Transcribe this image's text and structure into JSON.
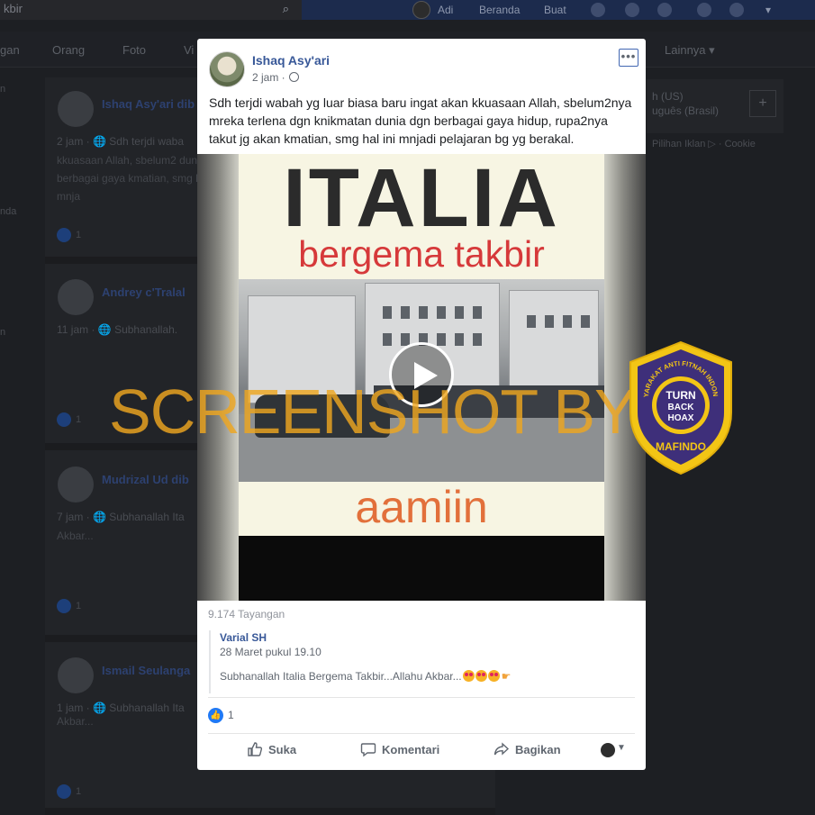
{
  "topbar": {
    "search_value": "kbir",
    "user_name": "Adi",
    "home": "Beranda",
    "create": "Buat"
  },
  "navbar": {
    "items": [
      "gan",
      "Orang",
      "Foto",
      "Vi",
      "Lainnya ▾"
    ]
  },
  "background_posts": [
    {
      "name": "Ishaq Asy'ari dib",
      "meta": "2 jam · 🌐  Sdh terjdi waba",
      "text": "kkuasaan Allah, sbelum2 dunia dgn berbagai gaya kmatian, smg hal ini mnja",
      "likes": "1"
    },
    {
      "name": "Andrey c'Tralal",
      "meta": "11 jam · 🌐  Subhanallah.",
      "text": "",
      "likes": "1"
    },
    {
      "name": "Mudrizal Ud dib",
      "meta": "7 jam · 🌐  Subhanallah Ita",
      "text": "Akbar...",
      "likes": "1"
    },
    {
      "name": "Ismail Seulanga",
      "meta": "1 jam · 🌐  Subhanallah Ita",
      "text": "Akbar...",
      "likes": "1"
    }
  ],
  "background_side": [
    "n",
    "nda",
    "n"
  ],
  "right_panel": {
    "line1": "h (US)",
    "line2": "uguês (Brasil)",
    "footer": "Pilihan Iklan ▷ · Cookie"
  },
  "post": {
    "author": "Ishaq Asy'ari",
    "time": "2 jam ·",
    "more_label": "•••",
    "text": "Sdh terjdi wabah yg luar biasa baru ingat akan kkuasaan Allah, sbelum2nya mreka terlena dgn knikmatan dunia dgn berbagai gaya hidup, rupa2nya takut jg akan kmatian, smg hal ini mnjadi pelajaran bg yg berakal."
  },
  "video": {
    "line1": "ITALIA",
    "line2": "bergema takbir",
    "line3": "aamiin"
  },
  "views": "9.174 Tayangan",
  "shared_quote": {
    "name": "Varial SH",
    "date": "28 Maret pukul 19.10",
    "text": "Subhanallah Italia Bergema Takbir...Allahu Akbar..."
  },
  "reactions": {
    "count": "1"
  },
  "actions": {
    "like": "Suka",
    "comment": "Komentari",
    "share": "Bagikan"
  },
  "watermark": {
    "text": "SCREENSHOT BY",
    "badge_ring": "MASYARAKAT ANTI FITNAH INDONESIA",
    "badge_center_1": "TURN",
    "badge_center_2": "BACK",
    "badge_center_3": "HOAX",
    "badge_bottom": "MAFINDO"
  },
  "colors": {
    "accent": "#385898",
    "like_blue": "#2079f5",
    "watermark": "#eea620",
    "badge_purple": "#3e2f7a",
    "badge_gold": "#f3c515"
  }
}
